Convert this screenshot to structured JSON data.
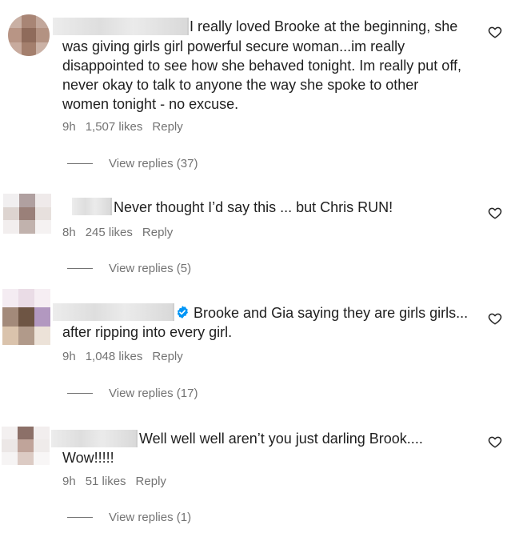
{
  "comments": [
    {
      "text_lines": [
        "I really loved Brooke at the beginning, she",
        "was giving girls girl powerful secure woman...im really",
        "disappointed to see how she behaved tonight. Im really put off,",
        "never okay to talk to anyone the way she spoke to other",
        "women tonight - no excuse."
      ],
      "time": "9h",
      "likes": "1,507 likes",
      "reply": "Reply",
      "view_replies": "View replies (37)",
      "icon": "heart-outline-icon"
    },
    {
      "text_lines": [
        "Never thought I’d say this ... but Chris RUN!"
      ],
      "time": "8h",
      "likes": "245 likes",
      "reply": "Reply",
      "view_replies": "View replies (5)",
      "icon": "heart-outline-icon"
    },
    {
      "text_lines": [
        "Brooke and Gia saying they are girls girls...",
        "after ripping into every girl."
      ],
      "time": "9h",
      "likes": "1,048 likes",
      "reply": "Reply",
      "view_replies": "View replies (17)",
      "verified_icon": "verified-badge-icon",
      "icon": "heart-outline-icon"
    },
    {
      "text_lines": [
        "Well well well aren’t you just darling Brook....",
        "Wow!!!!!"
      ],
      "time": "9h",
      "likes": "51 likes",
      "reply": "Reply",
      "view_replies": "View replies (1)",
      "icon": "heart-outline-icon"
    }
  ],
  "colors": {
    "text": "#1f1f1f",
    "meta": "#737373",
    "verified": "#0095f6"
  }
}
